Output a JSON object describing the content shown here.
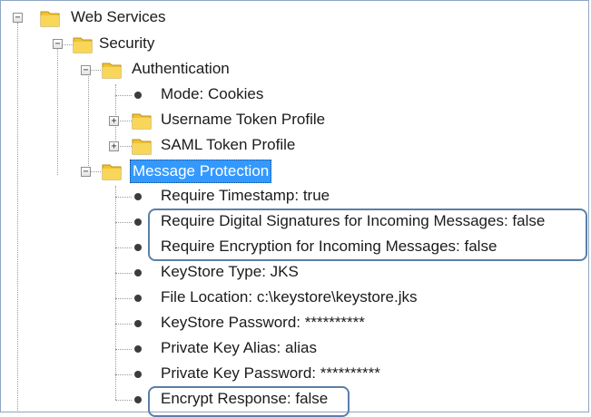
{
  "tree": {
    "web_services": {
      "label": "Web Services",
      "toggle": "−"
    },
    "security": {
      "label": "Security",
      "toggle": "−"
    },
    "authentication": {
      "label": "Authentication",
      "toggle": "−",
      "mode": "Mode: Cookies",
      "username_token": {
        "label": "Username Token Profile",
        "toggle": "+"
      },
      "saml_token": {
        "label": "SAML Token Profile",
        "toggle": "+"
      }
    },
    "message_protection": {
      "label": "Message Protection",
      "toggle": "−",
      "items": [
        "Require Timestamp: true",
        "Require Digital Signatures for Incoming Messages: false",
        "Require Encryption for Incoming Messages: false",
        "KeyStore Type: JKS",
        "File Location: c:\\keystore\\keystore.jks",
        "KeyStore Password: **********",
        "Private Key Alias: alias",
        "Private Key Password: **********",
        "Encrypt Response: false"
      ]
    }
  },
  "colors": {
    "selection": "#3399ff",
    "callout_border": "#5b7fa8",
    "folder": "#f2c230"
  },
  "icons": {
    "folder": "folder-icon",
    "leaf": "bullet-icon",
    "expand": "plus-icon",
    "collapse": "minus-icon"
  }
}
